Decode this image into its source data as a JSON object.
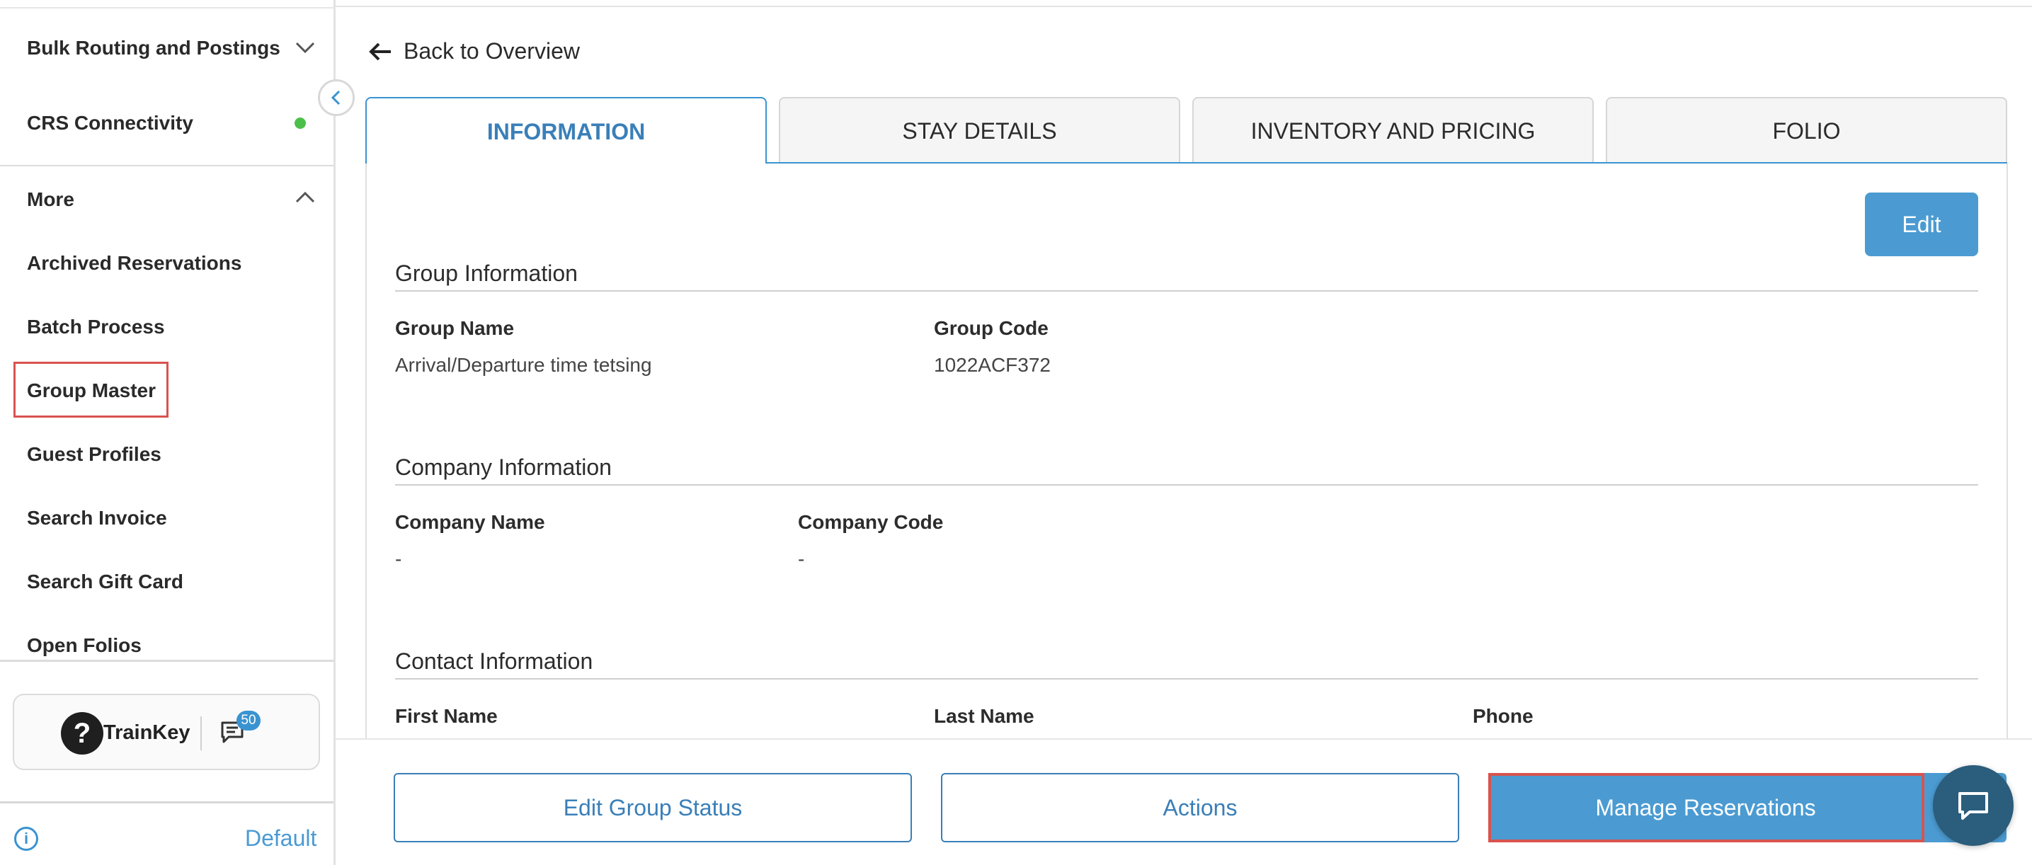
{
  "sidebar": {
    "bulk_routing": "Bulk Routing and Postings",
    "crs_connectivity": "CRS Connectivity",
    "more": "More",
    "items": [
      "Archived Reservations",
      "Batch Process",
      "Group Master",
      "Guest Profiles",
      "Search Invoice",
      "Search Gift Card",
      "Open Folios"
    ],
    "selected_item": "Group Master",
    "status_dot_color": "#4cc04a",
    "trainkey_label": "TrainKey",
    "help_icon_glyph": "?",
    "message_badge": "50",
    "footer_link": "Default"
  },
  "main": {
    "back_link": "Back to Overview",
    "tabs": [
      "INFORMATION",
      "STAY DETAILS",
      "INVENTORY AND PRICING",
      "FOLIO"
    ],
    "active_tab": "INFORMATION",
    "edit_button": "Edit",
    "group_info": {
      "title": "Group Information",
      "name_label": "Group Name",
      "name_value": "Arrival/Departure time tetsing",
      "code_label": "Group Code",
      "code_value": "1022ACF372"
    },
    "company_info": {
      "title": "Company Information",
      "name_label": "Company Name",
      "name_value": "-",
      "code_label": "Company Code",
      "code_value": "-"
    },
    "contact_info": {
      "title": "Contact Information",
      "first_name_label": "First Name",
      "last_name_label": "Last Name",
      "phone_label": "Phone"
    }
  },
  "actions": {
    "edit_group_status": "Edit Group Status",
    "actions": "Actions",
    "manage_reservations": "Manage Reservations"
  },
  "colors": {
    "accent": "#3a93d1",
    "primary_button": "#4b9bd2",
    "highlight_border": "#d9534f",
    "chat_fab": "#2b5d7c"
  }
}
